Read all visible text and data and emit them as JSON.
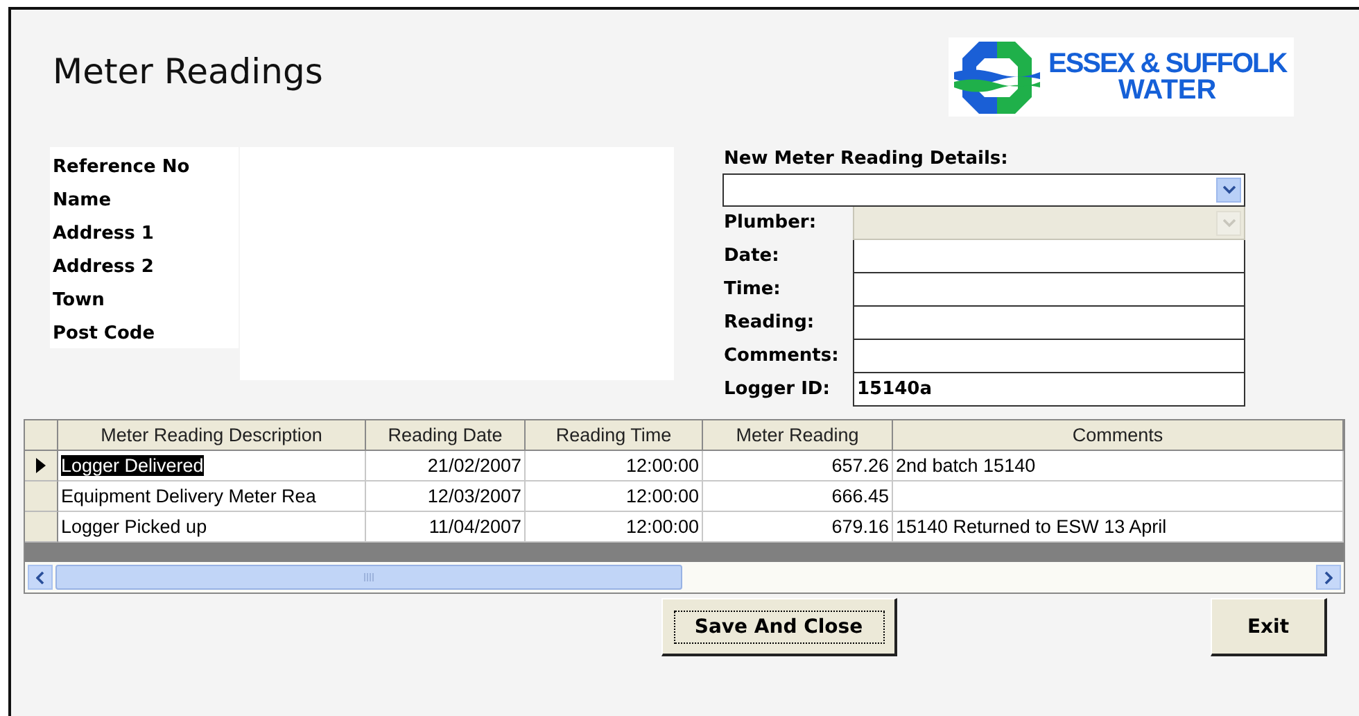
{
  "window": {
    "title": "Meter Readings"
  },
  "logo": {
    "line_1": "ESSEX & SUFFOLK",
    "line_2": "WATER"
  },
  "customer": {
    "labels": [
      "Reference No",
      "Name",
      "Address 1",
      "Address 2",
      "Town",
      "Post Code"
    ]
  },
  "new_reading": {
    "heading": "New Meter Reading Details:",
    "fields": [
      {
        "label": "Plumber:",
        "kind": "dropdown",
        "disabled": true
      },
      {
        "label": "Date:",
        "kind": "text",
        "disabled": false
      },
      {
        "label": "Time:",
        "kind": "text",
        "disabled": false
      },
      {
        "label": "Reading:",
        "kind": "text",
        "disabled": false
      },
      {
        "label": "Comments:",
        "kind": "text",
        "disabled": false
      },
      {
        "label": "Logger ID:",
        "kind": "text",
        "disabled": false,
        "value": "15140a"
      }
    ]
  },
  "table": {
    "columns": [
      "Meter Reading Description",
      "Reading Date",
      "Reading Time",
      "Meter Reading",
      "Comments"
    ],
    "rows": [
      {
        "description": "Logger Delivered",
        "reading_date": "21/02/2007",
        "reading_time": "12:00:00",
        "meter_reading": "657.26",
        "comments": "2nd batch 15140",
        "selected": true
      },
      {
        "description": "Equipment Delivery Meter Rea",
        "reading_date": "12/03/2007",
        "reading_time": "12:00:00",
        "meter_reading": "666.45",
        "selected": false
      },
      {
        "description": "Logger Picked up",
        "reading_date": "11/04/2007",
        "reading_time": "12:00:00",
        "meter_reading": "679.16",
        "comments": "15140 Returned to ESW 13 April",
        "selected": false
      }
    ]
  },
  "buttons": [
    {
      "label": "Save And Close",
      "focused": true
    },
    {
      "label": "Exit",
      "focused": false
    }
  ]
}
